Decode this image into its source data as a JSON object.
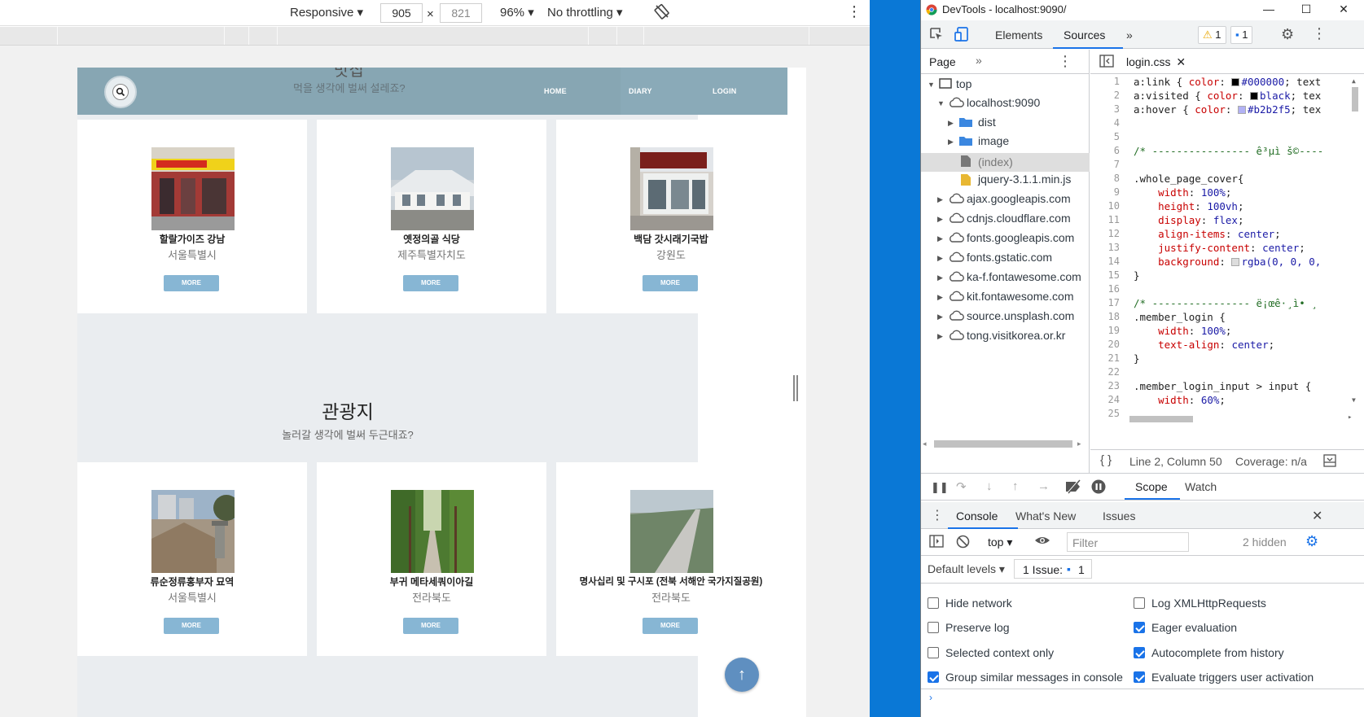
{
  "device_toolbar": {
    "device": "Responsive",
    "width": "905",
    "height": "821",
    "zoom": "96%",
    "throttling": "No throttling"
  },
  "site": {
    "header_title_cut": "맛집",
    "header_sub": "먹을 생각에 벌써 설레죠?",
    "nav": [
      "HOME",
      "DIARY",
      "LOGIN"
    ],
    "restaurants": [
      {
        "name": "할랄가이즈 강남",
        "region": "서울특별시",
        "more": "MORE"
      },
      {
        "name": "옛정의골 식당",
        "region": "제주특별자치도",
        "more": "MORE"
      },
      {
        "name": "백담 갓시래기국밥",
        "region": "강원도",
        "more": "MORE"
      }
    ],
    "tour_title": "관광지",
    "tour_sub": "놀러갈 생각에 벌써 두근대죠?",
    "tours": [
      {
        "name": "류순정류홍부자 묘역",
        "region": "서울특별시",
        "more": "MORE"
      },
      {
        "name": "부귀 메타세쿼이아길",
        "region": "전라북도",
        "more": "MORE"
      },
      {
        "name": "명사십리 및 구시포 (전북 서해안 국가지질공원)",
        "region": "전라북도",
        "more": "MORE"
      }
    ],
    "to_top": "↑"
  },
  "devtools": {
    "window_title": "DevTools - localhost:9090/",
    "tabs": [
      "Elements",
      "Sources"
    ],
    "warnings": "1",
    "messages": "1",
    "navigator_tab": "Page",
    "tree": {
      "top": "top",
      "host": "localhost:9090",
      "folders": [
        "dist",
        "image"
      ],
      "files": [
        "(index)",
        "jquery-3.1.1.min.js"
      ],
      "origins": [
        "ajax.googleapis.com",
        "cdnjs.cloudflare.com",
        "fonts.googleapis.com",
        "fonts.gstatic.com",
        "ka-f.fontawesome.com",
        "kit.fontawesome.com",
        "source.unsplash.com",
        "tong.visitkorea.or.kr"
      ]
    },
    "file_tab": "login.css",
    "code_line_numbers": [
      "1",
      "2",
      "3",
      "4",
      "5",
      "6",
      "7",
      "8",
      "9",
      "10",
      "11",
      "12",
      "13",
      "14",
      "15",
      "16",
      "17",
      "18",
      "19",
      "20",
      "21",
      "22",
      "23",
      "24",
      "25"
    ],
    "code": {
      "l1_sel": "a:link { ",
      "l1_prop": "color",
      "l1_val": "#000000",
      "l1_tail": "; text",
      "l2_sel": "a:visited { ",
      "l2_prop": "color",
      "l2_val": "black",
      "l2_tail": "; tex",
      "l3_sel": "a:hover { ",
      "l3_prop": "color",
      "l3_val": "#b2b2f5",
      "l3_tail": "; tex",
      "l6": "/* ---------------- ê³µì š©----",
      "l8": ".whole_page_cover{",
      "l9_prop": "width",
      "l9_val": "100%",
      "l10_prop": "height",
      "l10_val": "100vh",
      "l11_prop": "display",
      "l11_val": "flex",
      "l12_prop": "align-items",
      "l12_val": "center",
      "l13_prop": "justify-content",
      "l13_val": "center",
      "l14_prop": "background",
      "l14_val": "rgba(0, 0, 0,",
      "l15": "}",
      "l17": "/* ---------------- ë¡œê·¸ì• ¸",
      "l18": ".member_login {",
      "l19_prop": "width",
      "l19_val": "100%",
      "l20_prop": "text-align",
      "l20_val": "center",
      "l21": "}",
      "l23": ".member_login_input > input {",
      "l24_prop": "width",
      "l24_val": "60%"
    },
    "cursor_pos": "Line 2, Column 50",
    "coverage": "Coverage: n/a",
    "debug_tabs": [
      "Scope",
      "Watch"
    ],
    "drawer_tabs": [
      "Console",
      "What's New",
      "Issues"
    ],
    "context": "top",
    "filter_placeholder": "Filter",
    "hidden": "2 hidden",
    "levels": "Default levels",
    "issues_label": "1 Issue:",
    "issues_count": "1",
    "settings_left": [
      {
        "label": "Hide network",
        "checked": false
      },
      {
        "label": "Preserve log",
        "checked": false
      },
      {
        "label": "Selected context only",
        "checked": false
      },
      {
        "label": "Group similar messages in console",
        "checked": true
      }
    ],
    "settings_right": [
      {
        "label": "Log XMLHttpRequests",
        "checked": false
      },
      {
        "label": "Eager evaluation",
        "checked": true
      },
      {
        "label": "Autocomplete from history",
        "checked": true
      },
      {
        "label": "Evaluate triggers user activation",
        "checked": true
      }
    ]
  },
  "colors": {
    "header": "#87a6b3",
    "more_button": "#87b6d4",
    "desktop": "#0a78d6",
    "accent": "#1a73e8"
  }
}
